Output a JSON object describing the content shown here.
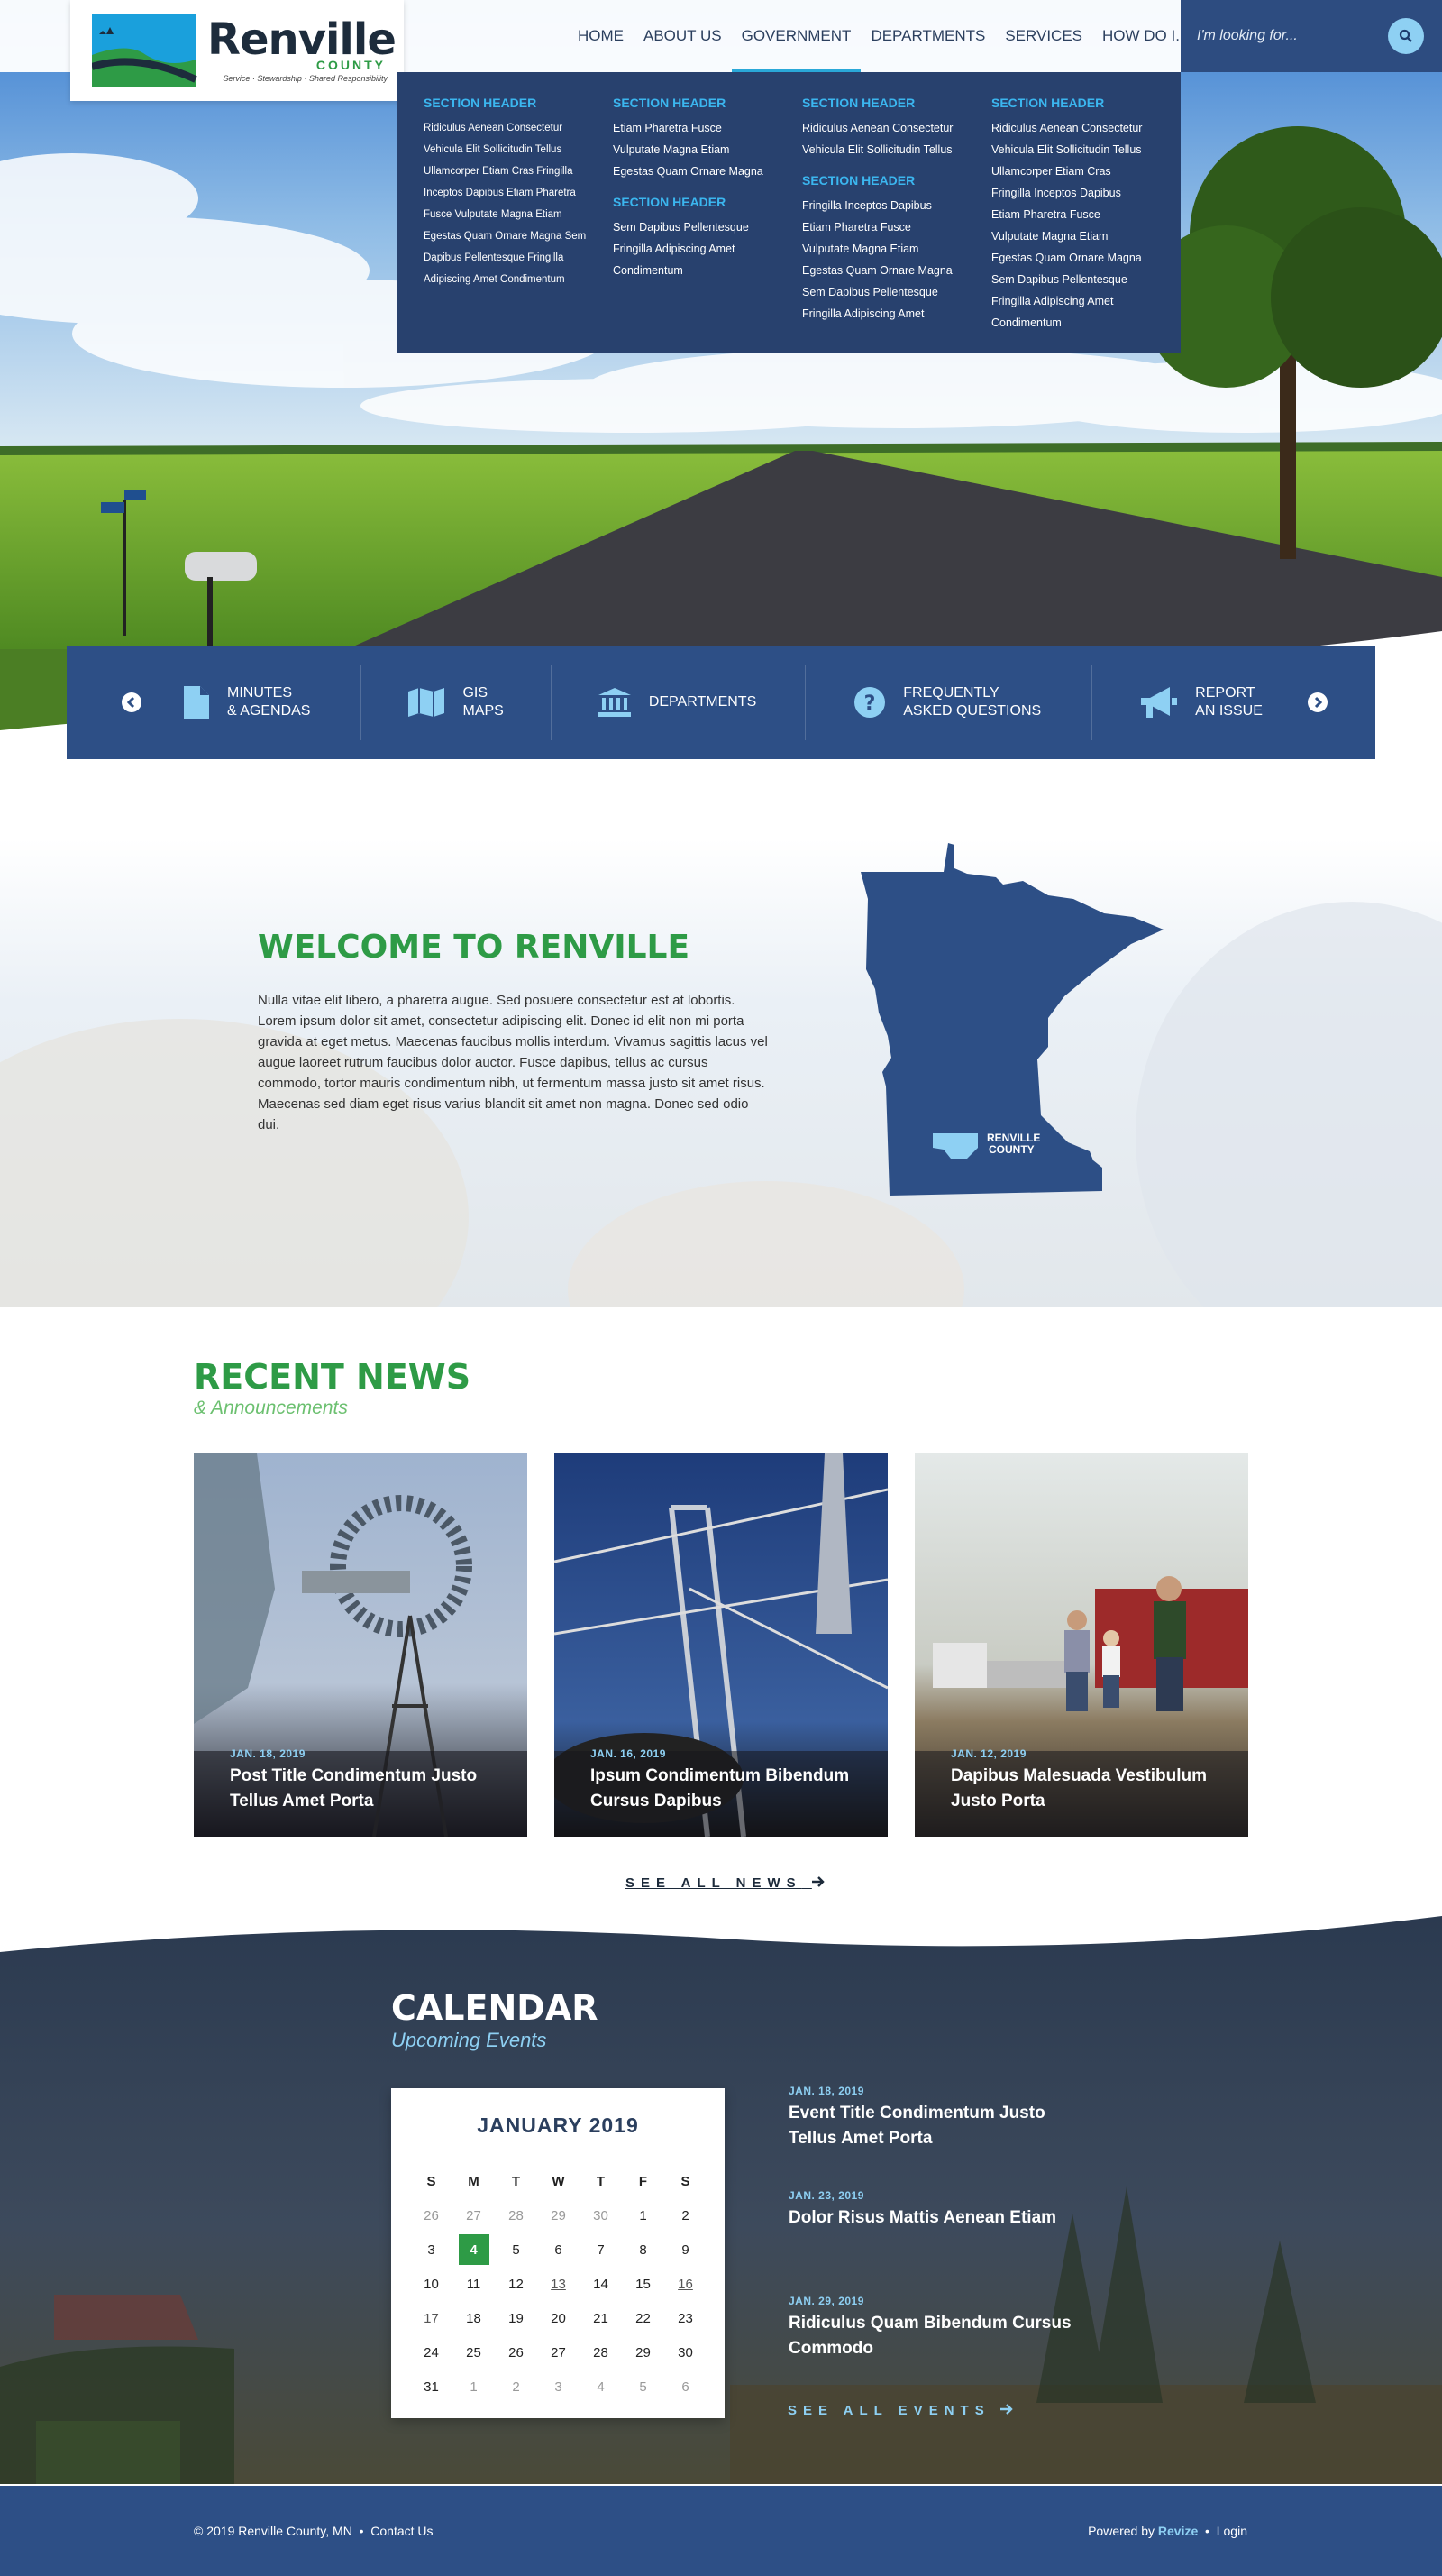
{
  "logo": {
    "name": "Renville",
    "county": "COUNTY",
    "tagline": "Service · Stewardship · Shared Responsibility"
  },
  "nav": [
    "HOME",
    "ABOUT US",
    "GOVERNMENT",
    "DEPARTMENTS",
    "SERVICES",
    "HOW DO I..."
  ],
  "nav_active": "GOVERNMENT",
  "search": {
    "placeholder": "I'm looking for..."
  },
  "mega": {
    "col1": {
      "header": "SECTION HEADER",
      "items": [
        "Ridiculus Aenean Consectetur",
        "Vehicula Elit Sollicitudin Tellus",
        "Ullamcorper Etiam Cras Fringilla",
        "Inceptos Dapibus Etiam Pharetra",
        "Fusce Vulputate Magna Etiam",
        "Egestas Quam Ornare Magna Sem",
        "Dapibus Pellentesque Fringilla",
        "Adipiscing Amet Condimentum"
      ]
    },
    "col2a": {
      "header": "SECTION HEADER",
      "items": [
        "Etiam Pharetra Fusce",
        "Vulputate Magna Etiam",
        "Egestas Quam Ornare Magna"
      ]
    },
    "col2b": {
      "header": "SECTION HEADER",
      "items": [
        "Sem Dapibus Pellentesque",
        "Fringilla Adipiscing Amet Condimentum"
      ]
    },
    "col3a": {
      "header": "SECTION HEADER",
      "items": [
        "Ridiculus Aenean Consectetur",
        "Vehicula Elit Sollicitudin Tellus"
      ]
    },
    "col3b": {
      "header": "SECTION HEADER",
      "items": [
        "Fringilla Inceptos Dapibus",
        "Etiam Pharetra Fusce",
        "Vulputate Magna Etiam",
        "Egestas Quam Ornare Magna",
        "Sem Dapibus Pellentesque",
        "Fringilla Adipiscing Amet"
      ]
    },
    "col4": {
      "header": "SECTION HEADER",
      "items": [
        "Ridiculus Aenean Consectetur",
        "Vehicula Elit Sollicitudin Tellus",
        "Ullamcorper Etiam Cras",
        "Fringilla Inceptos Dapibus",
        "Etiam Pharetra Fusce",
        "Vulputate Magna Etiam",
        "Egestas Quam Ornare Magna",
        "Sem Dapibus Pellentesque",
        "Fringilla Adipiscing Amet Condimentum"
      ]
    }
  },
  "quick_links": [
    {
      "l1": "MINUTES",
      "l2": "& AGENDAS",
      "icon": "document-icon"
    },
    {
      "l1": "GIS",
      "l2": "MAPS",
      "icon": "map-icon"
    },
    {
      "l1": "DEPARTMENTS",
      "l2": "",
      "icon": "building-icon"
    },
    {
      "l1": "FREQUENTLY",
      "l2": "ASKED QUESTIONS",
      "icon": "question-icon"
    },
    {
      "l1": "REPORT",
      "l2": "AN ISSUE",
      "icon": "megaphone-icon"
    }
  ],
  "welcome": {
    "title": "WELCOME TO RENVILLE",
    "body": "Nulla vitae elit libero, a pharetra augue. Sed posuere consectetur est at lobortis. Lorem ipsum dolor sit amet, consectetur adipiscing elit. Donec id elit non mi porta gravida at eget metus. Maecenas faucibus mollis interdum. Vivamus sagittis lacus vel augue laoreet rutrum faucibus dolor auctor. Fusce dapibus, tellus ac cursus commodo, tortor mauris condimentum nibh, ut fermentum massa justo sit amet risus. Maecenas sed diam eget risus varius blandit sit amet non magna. Donec sed odio dui.",
    "map_label_1": "RENVILLE",
    "map_label_2": "COUNTY"
  },
  "news": {
    "title": "RECENT NEWS",
    "subtitle": "& Announcements",
    "items": [
      {
        "date": "JAN. 18, 2019",
        "title": "Post Title Condimentum Justo Tellus Amet Porta"
      },
      {
        "date": "JAN. 16, 2019",
        "title": "Ipsum Condimentum Bibendum Cursus Dapibus"
      },
      {
        "date": "JAN. 12, 2019",
        "title": "Dapibus Malesuada Vestibulum Justo Porta"
      }
    ],
    "see_all": "SEE ALL NEWS"
  },
  "calendar": {
    "title": "CALENDAR",
    "subtitle": "Upcoming Events",
    "month": "JANUARY 2019",
    "day_headers": [
      "S",
      "M",
      "T",
      "W",
      "T",
      "F",
      "S"
    ],
    "days": [
      "26",
      "27",
      "28",
      "29",
      "30",
      "1",
      "2",
      "3",
      "4",
      "5",
      "6",
      "7",
      "8",
      "9",
      "10",
      "11",
      "12",
      "13",
      "14",
      "15",
      "16",
      "17",
      "18",
      "19",
      "20",
      "21",
      "22",
      "23",
      "24",
      "25",
      "26",
      "27",
      "28",
      "29",
      "30",
      "31",
      "1",
      "2",
      "3",
      "4",
      "5",
      "6"
    ],
    "today": "4",
    "events": [
      {
        "date": "JAN. 18, 2019",
        "title": "Event Title Condimentum Justo Tellus Amet Porta"
      },
      {
        "date": "JAN. 23, 2019",
        "title": "Dolor Risus Mattis Aenean Etiam"
      },
      {
        "date": "JAN. 29, 2019",
        "title": "Ridiculus Quam Bibendum Cursus Commodo"
      }
    ],
    "see_all": "SEE ALL EVENTS"
  },
  "footer": {
    "copyright": "© 2019 Renville County, MN",
    "contact": "Contact Us",
    "powered": "Powered by",
    "brand": "Revize",
    "login": "Login"
  },
  "colors": {
    "navy": "#2d4f86",
    "green": "#2e9b46",
    "light_blue": "#8ed0f3",
    "menu_bg": "#28416e"
  }
}
